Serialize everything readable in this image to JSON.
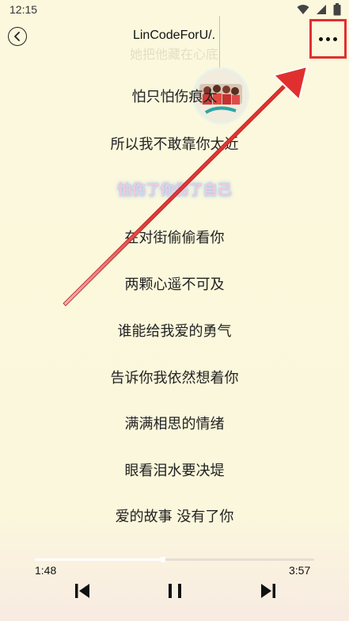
{
  "status_bar": {
    "time": "12:15",
    "icons": [
      "wifi-icon",
      "signal-icon",
      "battery-icon"
    ]
  },
  "header": {
    "title": "LinCodeForU/."
  },
  "faded_lyric": "她把他藏在心底",
  "lyrics": [
    "怕只怕伤痕太",
    "所以我不敢靠你太近",
    "怕伤了你伤了自己",
    "在对街偷偷看你",
    "两颗心遥不可及",
    "谁能给我爱的勇气",
    "告诉你我依然想着你",
    "满满相思的情绪",
    "眼看泪水要决堤",
    "爱的故事 没有了你"
  ],
  "current_lyric_index": 2,
  "player": {
    "current_time": "1:48",
    "total_time": "3:57",
    "progress": 0.46
  },
  "colors": {
    "background": "#fbf7dc",
    "highlight": "#e12f2f",
    "arrow": "#e12f2f"
  }
}
